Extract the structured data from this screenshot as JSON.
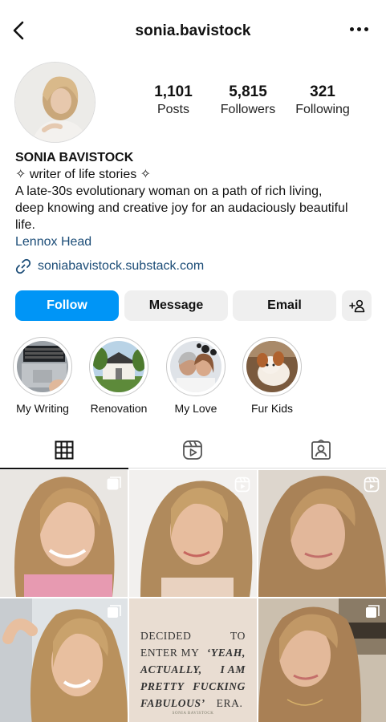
{
  "header": {
    "handle": "sonia.bavistock"
  },
  "profile": {
    "stats": [
      {
        "value": "1,101",
        "label": "Posts"
      },
      {
        "value": "5,815",
        "label": "Followers"
      },
      {
        "value": "321",
        "label": "Following"
      }
    ],
    "name": "SONIA BAVISTOCK",
    "tagline": "✧ writer of life stories ✧",
    "bio_lines": [
      "A late-30s evolutionary woman on a path of rich living,",
      "deep knowing and creative joy for an audaciously beautiful",
      "life."
    ],
    "location": "Lennox Head",
    "url": "soniabavistock.substack.com"
  },
  "actions": {
    "follow": "Follow",
    "message": "Message",
    "email": "Email"
  },
  "highlights": [
    {
      "label": "My Writing",
      "icon": "laptop-photo"
    },
    {
      "label": "Renovation",
      "icon": "house-photo"
    },
    {
      "label": "My Love",
      "icon": "couple-photo"
    },
    {
      "label": "Fur Kids",
      "icon": "dog-photo"
    }
  ],
  "tabs": [
    {
      "name": "grid-icon"
    },
    {
      "name": "reels-icon"
    },
    {
      "name": "tagged-icon"
    }
  ],
  "posts": [
    {
      "type": "carousel"
    },
    {
      "type": "reel"
    },
    {
      "type": "reel"
    },
    {
      "type": "carousel"
    },
    {
      "type": "quote",
      "quote_lines": [
        [
          "DECIDED",
          "TO"
        ],
        [
          "ENTER MY",
          "‘YEAH,"
        ],
        [
          "ACTUALLY,",
          "I AM"
        ],
        [
          "PRETTY",
          "FUCKING"
        ],
        [
          "FABULOUS’",
          "ERA."
        ]
      ],
      "signature": "SONIA BAVISTOCK"
    },
    {
      "type": "carousel"
    }
  ],
  "colors": {
    "accent": "#0095f6",
    "link": "#1b4c77",
    "button_bg": "#efefef"
  }
}
